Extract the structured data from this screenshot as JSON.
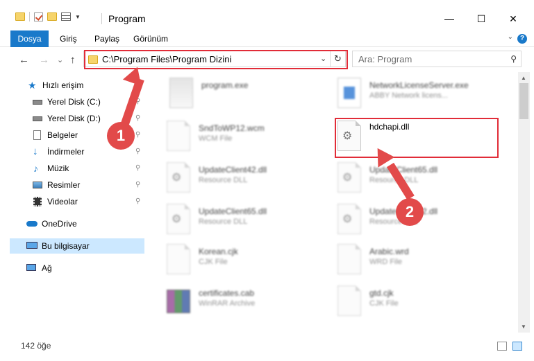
{
  "window": {
    "title": "Program",
    "buttons": {
      "minimize": "—",
      "maximize": "☐",
      "close": "✕"
    }
  },
  "ribbon": {
    "tabs": [
      {
        "label": "Dosya",
        "active": true
      },
      {
        "label": "Giriş"
      },
      {
        "label": "Paylaş"
      },
      {
        "label": "Görünüm"
      }
    ],
    "help": "?"
  },
  "nav": {
    "back": "←",
    "forward": "→",
    "recent": "⌄",
    "up": "↑",
    "address": "C:\\Program Files\\Program Dizini",
    "address_dropdown": "⌄",
    "refresh": "↻",
    "search_placeholder": "Ara: Program",
    "search_icon": "⚲"
  },
  "sidebar": {
    "items": [
      {
        "label": "Hızlı erişim",
        "icon": "star-icon",
        "pinned": false
      },
      {
        "label": "Yerel Disk (C:)",
        "icon": "drive-icon",
        "pinned": true
      },
      {
        "label": "Yerel Disk (D:)",
        "icon": "drive-icon",
        "pinned": true
      },
      {
        "label": "Belgeler",
        "icon": "documents-icon",
        "pinned": true
      },
      {
        "label": "İndirmeler",
        "icon": "download-icon",
        "pinned": true
      },
      {
        "label": "Müzik",
        "icon": "music-icon",
        "pinned": true
      },
      {
        "label": "Resimler",
        "icon": "pictures-icon",
        "pinned": true
      },
      {
        "label": "Videolar",
        "icon": "videos-icon",
        "pinned": true
      },
      {
        "label": "OneDrive",
        "icon": "cloud-icon",
        "pinned": false
      },
      {
        "label": "Bu bilgisayar",
        "icon": "computer-icon",
        "pinned": false,
        "selected": true
      },
      {
        "label": "Ağ",
        "icon": "network-icon",
        "pinned": false
      }
    ],
    "pin_glyph": "📌"
  },
  "files": [
    {
      "name": "program.exe",
      "type": "",
      "icon": "exe-icon",
      "blurred": true
    },
    {
      "name": "NetworkLicenseServer.exe",
      "type": "ABBY Network licens...",
      "icon": "exe-icon",
      "blurred": true
    },
    {
      "name": "SndToWP12.wcm",
      "type": "WCM File",
      "icon": "file-icon",
      "blurred": true
    },
    {
      "name": "hdchapi.dll",
      "type": "",
      "icon": "dll-gear-icon",
      "blurred": false
    },
    {
      "name": "UpdateClient42.dll",
      "type": "Resource DLL",
      "icon": "dll-gear-icon",
      "blurred": true
    },
    {
      "name": "UpdateClient65.dll",
      "type": "Resource DLL",
      "icon": "dll-gear-icon",
      "blurred": true
    },
    {
      "name": "UpdateClient65.dll",
      "type": "Resource DLL",
      "icon": "dll-gear-icon",
      "blurred": true
    },
    {
      "name": "UpdateClient42.dll",
      "type": "Resource DLL",
      "icon": "dll-gear-icon",
      "blurred": true
    },
    {
      "name": "Korean.cjk",
      "type": "CJK File",
      "icon": "file-icon",
      "blurred": true
    },
    {
      "name": "Arabic.wrd",
      "type": "WRD File",
      "icon": "file-icon",
      "blurred": true
    },
    {
      "name": "certificates.cab",
      "type": "WinRAR Archive",
      "icon": "archive-icon",
      "blurred": true
    },
    {
      "name": "gtd.cjk",
      "type": "CJK File",
      "icon": "file-icon",
      "blurred": true
    }
  ],
  "status": {
    "count": "142 öğe"
  },
  "annotations": {
    "step1": "1",
    "step2": "2"
  },
  "colors": {
    "accent": "#1979ca",
    "selection": "#cce8ff",
    "annotation_red": "#e24a4a"
  }
}
